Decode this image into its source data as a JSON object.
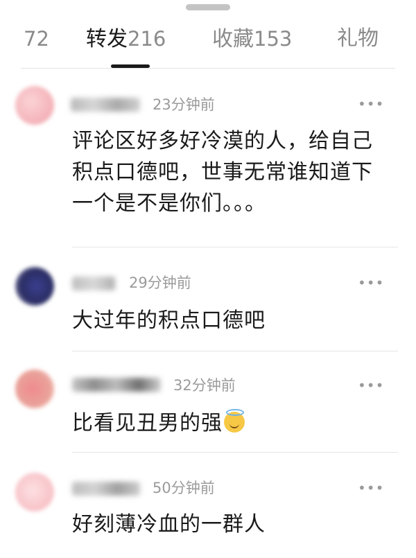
{
  "tabs": [
    {
      "label": "",
      "count": "72"
    },
    {
      "label": "转发",
      "count": "216"
    },
    {
      "label": "收藏",
      "count": "153"
    },
    {
      "label": "礼物",
      "count": ""
    }
  ],
  "comments": [
    {
      "time": "23分钟前",
      "text_lines": [
        "评论区好多好冷漠的人，给自己",
        "积点口德吧，世事无常谁知道下",
        "一个是不是你们。。。"
      ]
    },
    {
      "time": "29分钟前",
      "text_lines": [
        "大过年的积点口德吧"
      ]
    },
    {
      "time": "32分钟前",
      "text_lines": [
        "比看见丑男的强"
      ],
      "emoji": "smiling-face-with-halo"
    },
    {
      "time": "50分钟前",
      "text_lines": [
        "好刻薄冷血的一群人"
      ]
    }
  ],
  "more_glyph": "•••"
}
